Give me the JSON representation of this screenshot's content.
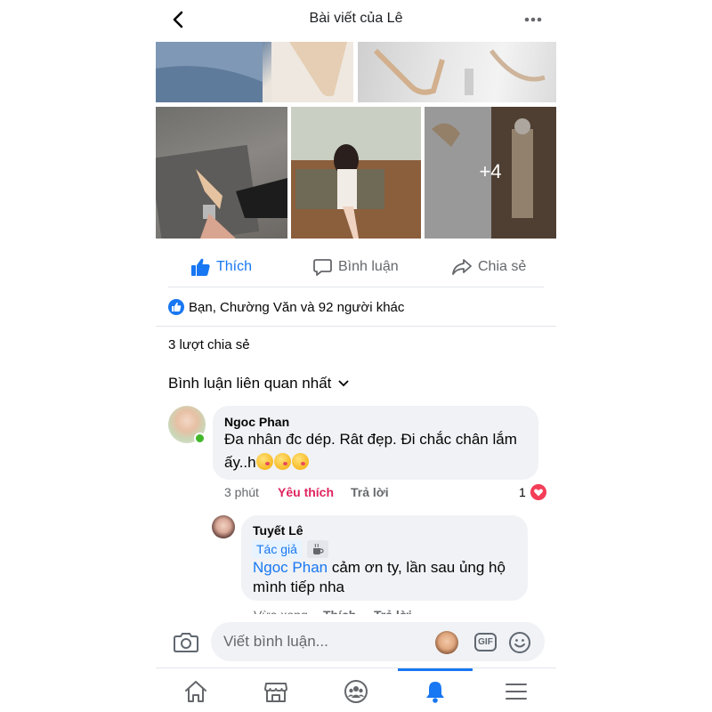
{
  "header": {
    "title": "Bài viết của Lê"
  },
  "photos": {
    "more_count": "+4"
  },
  "actions": {
    "like": "Thích",
    "comment": "Bình luận",
    "share": "Chia sẻ"
  },
  "reactions": {
    "summary": "Bạn, Chường Văn và 92 người khác"
  },
  "shares": {
    "text": "3 lượt chia sẻ"
  },
  "comments_filter": {
    "label": "Bình luận liên quan nhất"
  },
  "comments": [
    {
      "author": "Ngoc Phan",
      "line1": "Đa nhân đc dép. Rât đẹp. Đi chắc chân lắm",
      "line2": "ấy..h",
      "time": "3 phút",
      "liked_label": "Yêu thích",
      "reply_label": "Trả lời",
      "reaction_count": "1"
    }
  ],
  "reply": {
    "author": "Tuyết Lê",
    "badge": "Tác giả",
    "mention": "Ngoc Phan",
    "line1_rest": " cảm ơn ty, lần sau ủng hộ",
    "line2": "mình tiếp nha",
    "time": "Vừa xong",
    "like_label": "Thích",
    "reply_label": "Trả lời"
  },
  "composer": {
    "placeholder": "Viết bình luận...",
    "gif_label": "GIF"
  },
  "tabbar": {
    "items": [
      {
        "icon": "home-icon",
        "active": false
      },
      {
        "icon": "marketplace-icon",
        "active": false
      },
      {
        "icon": "groups-icon",
        "active": false
      },
      {
        "icon": "notifications-bell-icon",
        "active": true
      },
      {
        "icon": "menu-icon",
        "active": false
      }
    ],
    "accent": "#1877f2"
  },
  "colors": {
    "brand": "#1877f2",
    "love": "#e0245e",
    "online": "#42b72a"
  }
}
